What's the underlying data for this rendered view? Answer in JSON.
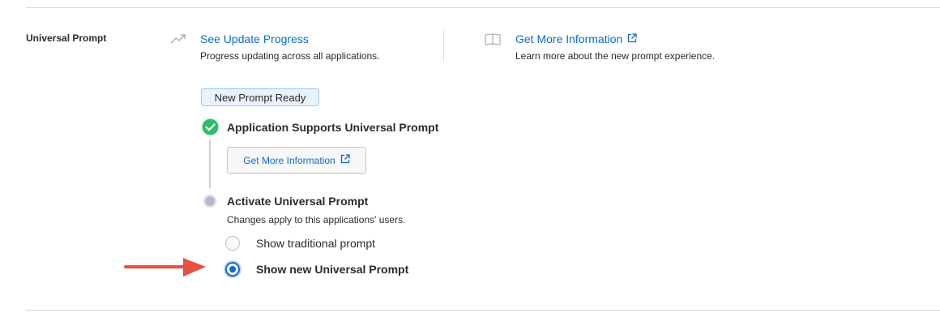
{
  "section": {
    "label": "Universal Prompt"
  },
  "update_progress": {
    "icon": "trending-up-icon",
    "link_label": "See Update Progress",
    "description": "Progress updating across all applications."
  },
  "more_info": {
    "icon": "book-icon",
    "link_label": "Get More Information",
    "link_icon": "external-link-icon",
    "description": "Learn more about the new prompt experience."
  },
  "badge": {
    "label": "New Prompt Ready"
  },
  "steps": [
    {
      "title": "Application Supports Universal Prompt",
      "status": "complete",
      "button_label": "Get More Information",
      "button_icon": "external-link-icon"
    },
    {
      "title": "Activate Universal Prompt",
      "status": "pending",
      "description": "Changes apply to this applications' users."
    }
  ],
  "options": [
    {
      "label": "Show traditional prompt",
      "selected": false
    },
    {
      "label": "Show new Universal Prompt",
      "selected": true
    }
  ],
  "colors": {
    "link": "#0b6bd3",
    "success": "#2ebd6b",
    "pending": "#b9b6cf",
    "badge_bg": "#e8f2fc",
    "arrow": "#e8503f"
  }
}
